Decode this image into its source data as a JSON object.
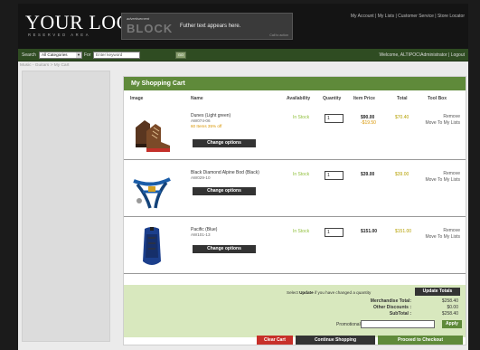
{
  "header": {
    "logo": "YOUR LOGO",
    "logo_sub": "RESERVED AREA",
    "ad_small": "advertisement",
    "ad_big": "BLOCK",
    "ad_text": "Futher text appears here.",
    "ad_link": "Call to action",
    "top_links": "My Account | My Lists | Customer Service | Store Locator"
  },
  "search": {
    "label": "Search",
    "category_selected": "All Categories",
    "for_label": "For",
    "keyword_value": "Enter keyword",
    "go_label": "GO",
    "welcome": "Welcome, ALTIPOC\\Administrator | Logout"
  },
  "breadcrumb": "Music - Guitars > My Cart",
  "cart": {
    "title": "My Shopping Cart",
    "columns": [
      "Image",
      "Name",
      "Availability",
      "Quantity",
      "Item Price",
      "Total",
      "Tool Box"
    ],
    "items": [
      {
        "name": "Dunes (Light green)",
        "sku": "AW074-06",
        "sale_note": "60 Items 35% off",
        "availability": "In Stock",
        "qty": "1",
        "price_old": "$90.00",
        "price_new": "-$19.50",
        "total": "$70.40",
        "tool_remove": "Remove",
        "tool_move": "Move To My Lists",
        "options_label": "Change options"
      },
      {
        "name": "Black Diamond Alpine Bod (Black)",
        "sku": "AW029-10",
        "availability": "In Stock",
        "qty": "1",
        "price_old": "$39.00",
        "total": "$39.00",
        "tool_remove": "Remove",
        "tool_move": "Move To My Lists",
        "options_label": "Change options"
      },
      {
        "name": "Pacific (Blue)",
        "sku": "AW101-13",
        "availability": "In Stock",
        "qty": "1",
        "price_old": "$151.00",
        "total": "$151.00",
        "tool_remove": "Remove",
        "tool_move": "Move To My Lists",
        "options_label": "Change options"
      }
    ],
    "update_note_pre": "Select",
    "update_note_bold": "Update",
    "update_note_post": "if you have changed a quantity",
    "update_label": "Update Totals",
    "merch_label": "Merchandise Total:",
    "merch_value": "$258.40",
    "discount_label": "Other Discounts :",
    "discount_value": "$0.00",
    "subtotal_label": "SubTotal :",
    "subtotal_value": "$258.40",
    "promo_label": "Promotional Code:",
    "apply_label": "Apply",
    "clear_label": "Clear Cart",
    "continue_label": "Continue Shopping",
    "checkout_label": "Proceed to Checkout"
  },
  "colors": {
    "header_bg": "#141414",
    "nav_green": "#2f4c22",
    "accent_green": "#5f8a3a",
    "summary_bg": "#d8e8be",
    "clear_red": "#c7302a",
    "sale_orange": "#d89500"
  }
}
